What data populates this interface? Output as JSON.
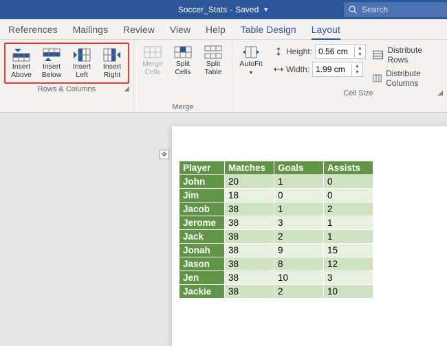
{
  "titlebar": {
    "filename": "Soccer_Stats",
    "status": "Saved",
    "search_placeholder": "Search"
  },
  "tabs": {
    "references": "References",
    "mailings": "Mailings",
    "review": "Review",
    "view": "View",
    "help": "Help",
    "table_design": "Table Design",
    "layout": "Layout"
  },
  "ribbon": {
    "rows_cols": {
      "label": "Rows & Columns",
      "insert_above": "Insert Above",
      "insert_below": "Insert Below",
      "insert_left": "Insert Left",
      "insert_right": "Insert Right"
    },
    "merge": {
      "label": "Merge",
      "merge_cells": "Merge Cells",
      "split_cells": "Split Cells",
      "split_table": "Split Table"
    },
    "autofit": "AutoFit",
    "cell_size": {
      "label": "Cell Size",
      "height_label": "Height:",
      "height_value": "0.56 cm",
      "width_label": "Width:",
      "width_value": "1.99 cm",
      "distribute_rows": "Distribute Rows",
      "distribute_columns": "Distribute Columns"
    }
  },
  "table": {
    "headers": [
      "Player",
      "Matches",
      "Goals",
      "Assists"
    ],
    "rows": [
      {
        "player": "John",
        "matches": "20",
        "goals": "1",
        "assists": "0"
      },
      {
        "player": "Jim",
        "matches": "18",
        "goals": "0",
        "assists": "0"
      },
      {
        "player": "Jacob",
        "matches": "38",
        "goals": "1",
        "assists": "2"
      },
      {
        "player": "Jerome",
        "matches": "38",
        "goals": "3",
        "assists": "1"
      },
      {
        "player": "Jack",
        "matches": "38",
        "goals": "2",
        "assists": "1"
      },
      {
        "player": "Jonah",
        "matches": "38",
        "goals": "9",
        "assists": "15"
      },
      {
        "player": "Jason",
        "matches": "38",
        "goals": "8",
        "assists": "12"
      },
      {
        "player": "Jen",
        "matches": "38",
        "goals": "10",
        "assists": "3"
      },
      {
        "player": "Jackie",
        "matches": "38",
        "goals": "2",
        "assists": "10"
      }
    ]
  }
}
